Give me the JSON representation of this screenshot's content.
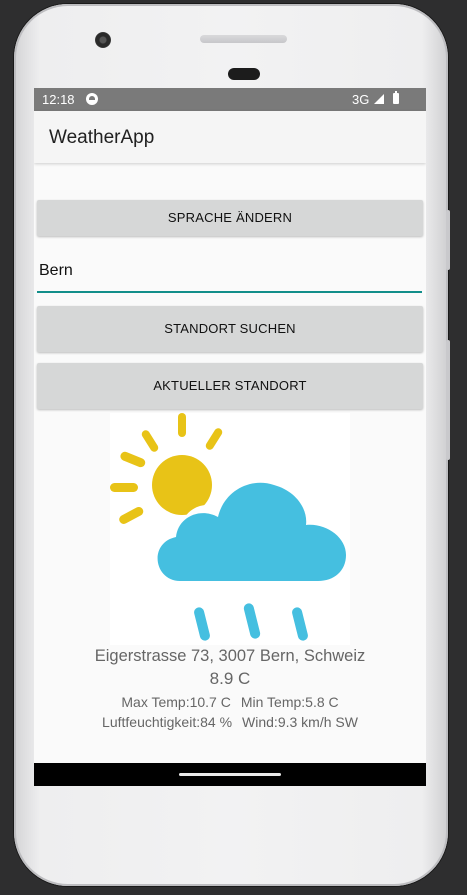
{
  "status_bar": {
    "time": "12:18",
    "network": "3G"
  },
  "app_bar": {
    "title": "WeatherApp"
  },
  "buttons": {
    "change_language": "SPRACHE ÄNDERN",
    "search_location": "STANDORT SUCHEN",
    "current_location": "AKTUELLER STANDORT"
  },
  "location_input": {
    "value": "Bern"
  },
  "weather": {
    "icon": "partly-cloudy-rain-icon",
    "address": "Eigerstrasse 73, 3007 Bern, Schweiz",
    "temperature": "8.9 C",
    "max_temp": "Max Temp:10.7 C",
    "min_temp": "Min Temp:5.8 C",
    "humidity": "Luftfeuchtigkeit:84 %",
    "wind": "Wind:9.3 km/h SW"
  },
  "colors": {
    "input_underline": "#128e8a",
    "sun": "#e8c317",
    "cloud": "#45bfe0"
  }
}
